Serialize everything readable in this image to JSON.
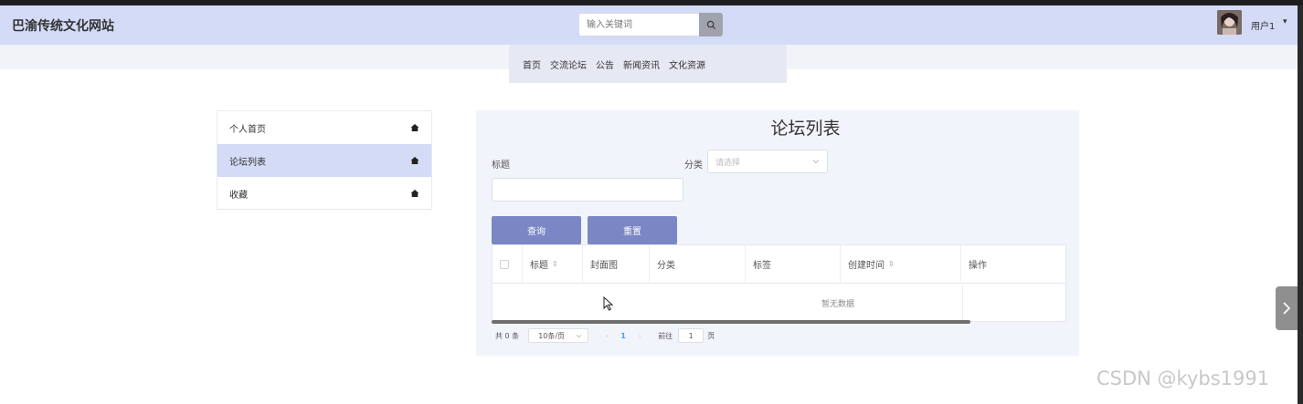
{
  "header": {
    "site_title": "巴渝传统文化网站",
    "search_placeholder": "输入关键词",
    "user_name": "用户1",
    "user_caret": "▾"
  },
  "nav": {
    "items": [
      {
        "label": "首页"
      },
      {
        "label": "交流论坛"
      },
      {
        "label": "公告"
      },
      {
        "label": "新闻资讯"
      },
      {
        "label": "文化资源"
      }
    ]
  },
  "sidebar": {
    "items": [
      {
        "label": "个人首页",
        "active": false
      },
      {
        "label": "论坛列表",
        "active": true
      },
      {
        "label": "收藏",
        "active": false
      }
    ]
  },
  "main": {
    "title": "论坛列表",
    "filters": {
      "title_label": "标题",
      "category_label": "分类",
      "category_placeholder": "请选择"
    },
    "buttons": {
      "query": "查询",
      "reset": "重置"
    },
    "table": {
      "columns": [
        "标题",
        "封面图",
        "分类",
        "标签",
        "创建时间",
        "操作"
      ],
      "empty_text": "暂无数据"
    },
    "pagination": {
      "total": "共 0 条",
      "page_size": "10条/页",
      "current_page": "1",
      "goto_label": "前往",
      "goto_value": "1",
      "page_suffix": "页"
    }
  },
  "watermark": "CSDN @kybs1991",
  "colors": {
    "header_bg": "#d3dbf7",
    "button_bg": "#7b87c4",
    "active_item_bg": "#d3dbf7"
  }
}
